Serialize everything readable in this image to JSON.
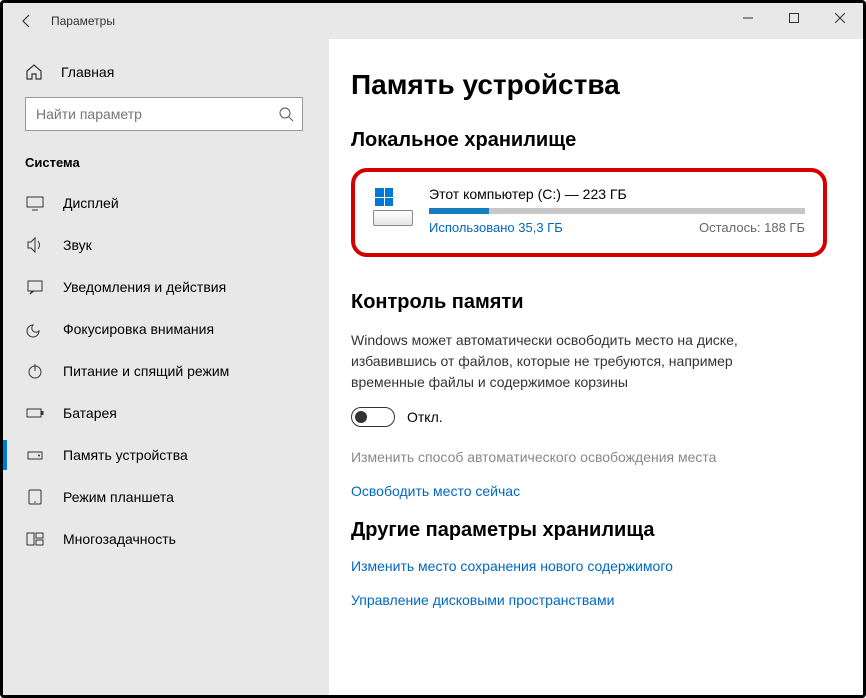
{
  "titlebar": {
    "title": "Параметры"
  },
  "sidebar": {
    "home": "Главная",
    "search_placeholder": "Найти параметр",
    "section": "Система",
    "items": [
      {
        "label": "Дисплей"
      },
      {
        "label": "Звук"
      },
      {
        "label": "Уведомления и действия"
      },
      {
        "label": "Фокусировка внимания"
      },
      {
        "label": "Питание и спящий режим"
      },
      {
        "label": "Батарея"
      },
      {
        "label": "Память устройства"
      },
      {
        "label": "Режим планшета"
      },
      {
        "label": "Многозадачность"
      }
    ]
  },
  "content": {
    "page_title": "Память устройства",
    "local_storage": {
      "heading": "Локальное хранилище",
      "drive_name": "Этот компьютер (C:) — 223 ГБ",
      "used": "Использовано 35,3 ГБ",
      "remaining": "Осталось: 188 ГБ"
    },
    "storage_sense": {
      "heading": "Контроль памяти",
      "description": "Windows может автоматически освободить место на диске, избавившись от файлов, которые не требуются, например временные файлы и содержимое корзины",
      "toggle_state": "Откл.",
      "change_link": "Изменить способ автоматического освобождения места",
      "free_now": "Освободить место сейчас"
    },
    "more": {
      "heading": "Другие параметры хранилища",
      "change_location": "Изменить место сохранения нового содержимого",
      "manage_spaces": "Управление дисковыми пространствами"
    }
  }
}
